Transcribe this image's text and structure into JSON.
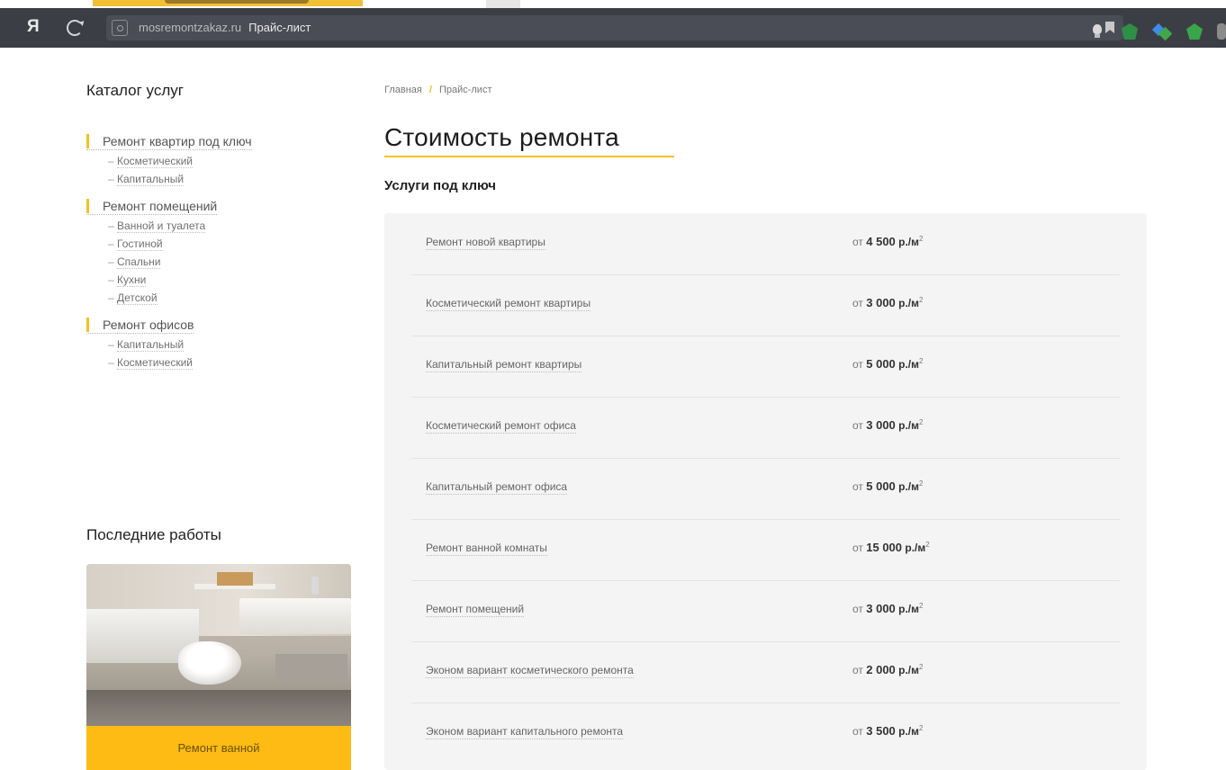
{
  "browser": {
    "logo": "Я",
    "url": "mosremontzakaz.ru",
    "page_title": "Прайс-лист"
  },
  "breadcrumb": {
    "home": "Главная",
    "separator": "/",
    "current": "Прайс-лист"
  },
  "sidebar": {
    "catalog_title": "Каталог услуг",
    "categories": [
      {
        "label": "Ремонт квартир под ключ",
        "items": [
          "Косметический",
          "Капитальный"
        ]
      },
      {
        "label": "Ремонт помещений",
        "items": [
          "Ванной и туалета",
          "Гостиной",
          "Спальни",
          "Кухни",
          "Детской"
        ]
      },
      {
        "label": "Ремонт офисов",
        "items": [
          "Капитальный",
          "Косметический"
        ]
      }
    ],
    "recent_title": "Последние работы",
    "recent_caption": "Ремонт ванной"
  },
  "main": {
    "title": "Стоимость ремонта",
    "section": "Услуги под ключ",
    "price_prefix": "от",
    "unit": "р./м",
    "unit_power": "2",
    "prices": [
      {
        "name": "Ремонт новой квартиры",
        "value": "4 500"
      },
      {
        "name": "Косметический ремонт квартиры",
        "value": "3 000"
      },
      {
        "name": "Капитальный ремонт квартиры",
        "value": "5 000"
      },
      {
        "name": "Косметический ремонт офиса",
        "value": "3 000"
      },
      {
        "name": "Капитальный ремонт офиса",
        "value": "5 000"
      },
      {
        "name": "Ремонт ванной комнаты",
        "value": "15 000"
      },
      {
        "name": "Ремонт помещений",
        "value": "3 000"
      },
      {
        "name": "Эконом вариант косметического ремонта",
        "value": "2 000"
      },
      {
        "name": "Эконом вариант капитального ремонта",
        "value": "3 500"
      }
    ]
  },
  "colors": {
    "accent": "#f5c121",
    "browser_bar": "#3c3e46",
    "panel": "#f4f4f4"
  }
}
